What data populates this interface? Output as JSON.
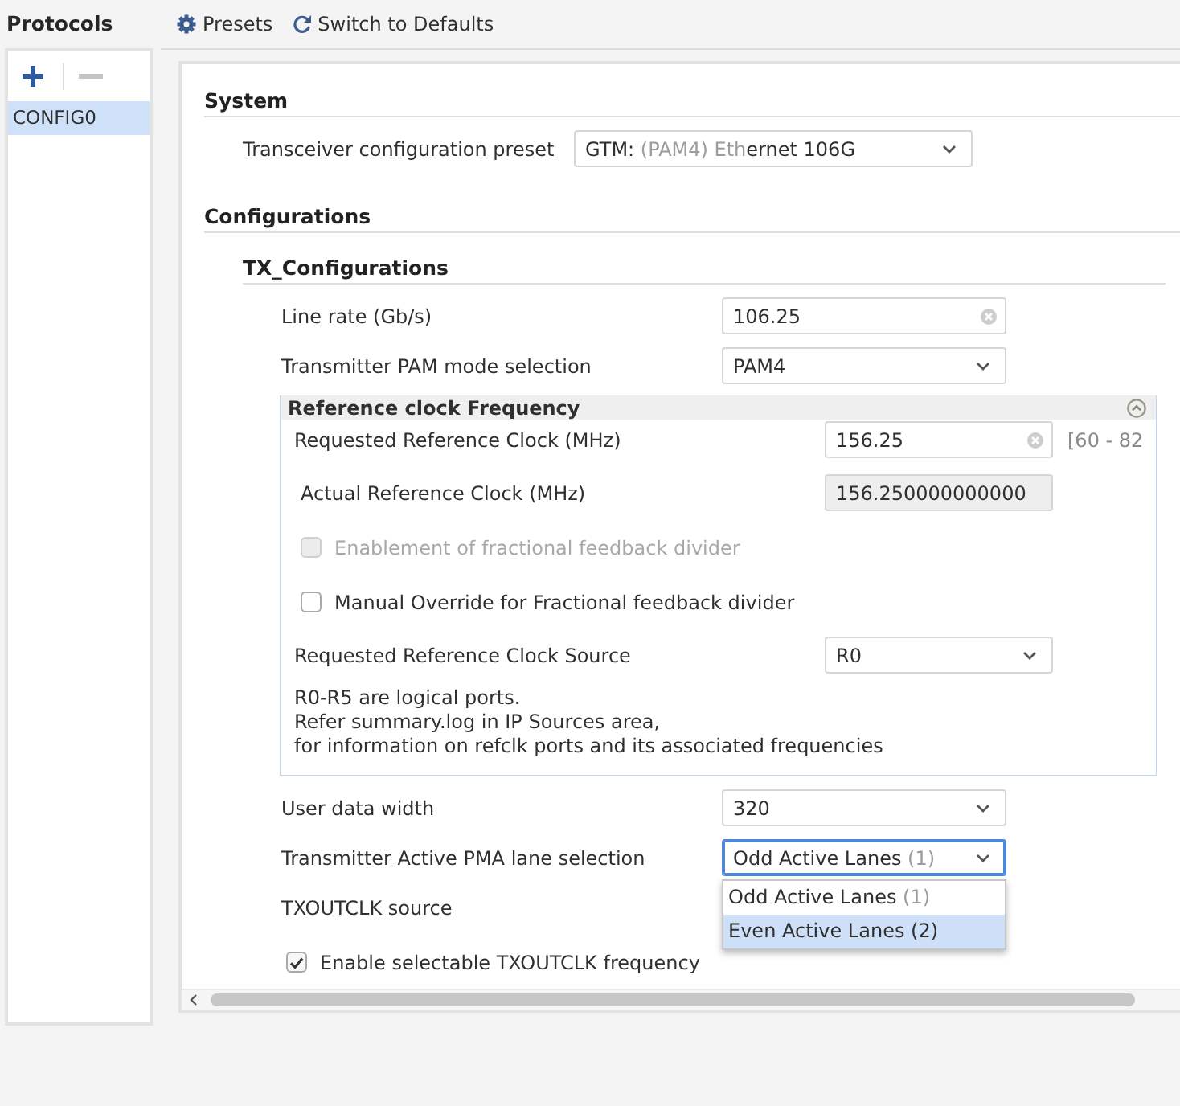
{
  "sidebar": {
    "title": "Protocols",
    "remove_disabled": true,
    "items": [
      {
        "label": "CONFIG0",
        "selected": true
      }
    ]
  },
  "toolbar": [
    {
      "kind": "presets",
      "label": "Presets"
    },
    {
      "kind": "defaults",
      "label": "Switch to Defaults"
    }
  ],
  "sections": [
    {
      "title": "System",
      "rows": [
        {
          "kind": "dropdown",
          "label": "Transceiver configuration preset",
          "value_parts": [
            {
              "text": "GTM: ",
              "muted": false
            },
            {
              "text": "(PAM4) Eth",
              "muted": true
            },
            {
              "text": "ernet 106G",
              "muted": false
            }
          ],
          "focused": false
        }
      ]
    },
    {
      "title": "Configurations",
      "subsections": [
        {
          "title": "TX_Configurations",
          "rows": [
            {
              "kind": "text",
              "label": "Line rate (Gb/s)",
              "value": "106.25"
            },
            {
              "kind": "dropdown",
              "label": "Transmitter PAM mode selection",
              "value": "PAM4",
              "focused": false
            },
            {
              "kind": "group",
              "title": "Reference clock Frequency",
              "expanded": true,
              "rows": [
                {
                  "kind": "text",
                  "label": "Requested Reference Clock (MHz)",
                  "value": "156.25",
                  "range": "[60 - 82"
                },
                {
                  "kind": "readonly",
                  "label": "Actual Reference Clock (MHz)",
                  "value": "156.250000000000"
                },
                {
                  "kind": "checkbox",
                  "label": "Enablement of fractional feedback divider",
                  "checked": false,
                  "disabled": true
                },
                {
                  "kind": "checkbox",
                  "label": "Manual Override for Fractional feedback divider",
                  "checked": false,
                  "disabled": false
                },
                {
                  "kind": "dropdown",
                  "label": "Requested Reference Clock Source",
                  "value": "R0",
                  "focused": false
                },
                {
                  "kind": "note",
                  "lines": [
                    "R0-R5 are logical ports.",
                    "Refer summary.log in IP Sources area,",
                    "for information on refclk ports and its associated frequencies"
                  ]
                }
              ]
            },
            {
              "kind": "dropdown",
              "label": "User data width",
              "value": "320",
              "focused": false
            },
            {
              "kind": "dropdown",
              "label": "Transmitter Active PMA lane selection",
              "value_parts": [
                {
                  "text": "Odd Active Lanes ",
                  "muted": false
                },
                {
                  "text": "(1)",
                  "muted": true
                }
              ],
              "focused": true,
              "expanded": true,
              "options": [
                {
                  "parts": [
                    {
                      "text": "Odd Active Lanes ",
                      "muted": false
                    },
                    {
                      "text": "(1)",
                      "muted": true
                    }
                  ],
                  "selected": false
                },
                {
                  "parts": [
                    {
                      "text": "Even Active Lanes (2)",
                      "muted": false
                    }
                  ],
                  "selected": true
                }
              ]
            },
            {
              "kind": "label",
              "label": "TXOUTCLK source"
            },
            {
              "kind": "checkbox",
              "label": "Enable selectable TXOUTCLK frequency",
              "checked": true,
              "disabled": false
            }
          ]
        }
      ]
    }
  ]
}
